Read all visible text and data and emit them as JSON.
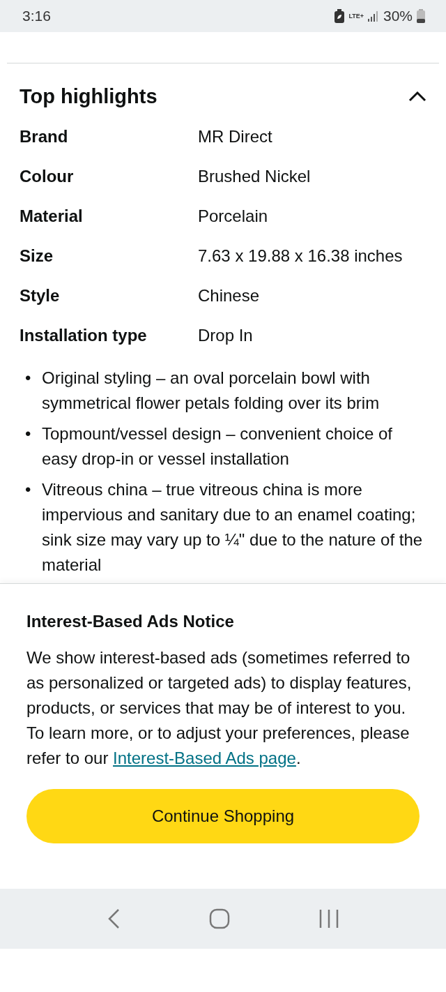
{
  "status_bar": {
    "time": "3:16",
    "network": "LTE+",
    "battery": "30%"
  },
  "section": {
    "title": "Top highlights",
    "expanded": true,
    "rows": [
      {
        "label": "Brand",
        "value": "MR Direct"
      },
      {
        "label": "Colour",
        "value": "Brushed Nickel"
      },
      {
        "label": "Material",
        "value": "Porcelain"
      },
      {
        "label": "Size",
        "value": "7.63 x 19.88 x 16.38 inches"
      },
      {
        "label": "Style",
        "value": "Chinese"
      },
      {
        "label": "Installation type",
        "value": "Drop In"
      }
    ],
    "bullets": [
      {
        "marker": "•",
        "text": "Original styling – an oval porcelain bowl with symmetrical flower petals folding over its brim"
      },
      {
        "marker": "•",
        "text": "Topmount/vessel design – convenient choice of easy drop-in or vessel installation"
      },
      {
        "marker": "•",
        "text": "Vitreous china – true vitreous china is more impervious and sanitary due to an enamel coating; sink size may vary up to ¼\" due to the nature of the material"
      }
    ]
  },
  "notice": {
    "title": "Interest-Based Ads Notice",
    "text": "We show interest-based ads (sometimes referred to as personalized or targeted ads) to display features, products, or services that may be of interest to you. To learn more, or to adjust your preferences, please refer to our",
    "link": "Interest-Based Ads page",
    "after_link": ".",
    "button": "Continue Shopping"
  }
}
